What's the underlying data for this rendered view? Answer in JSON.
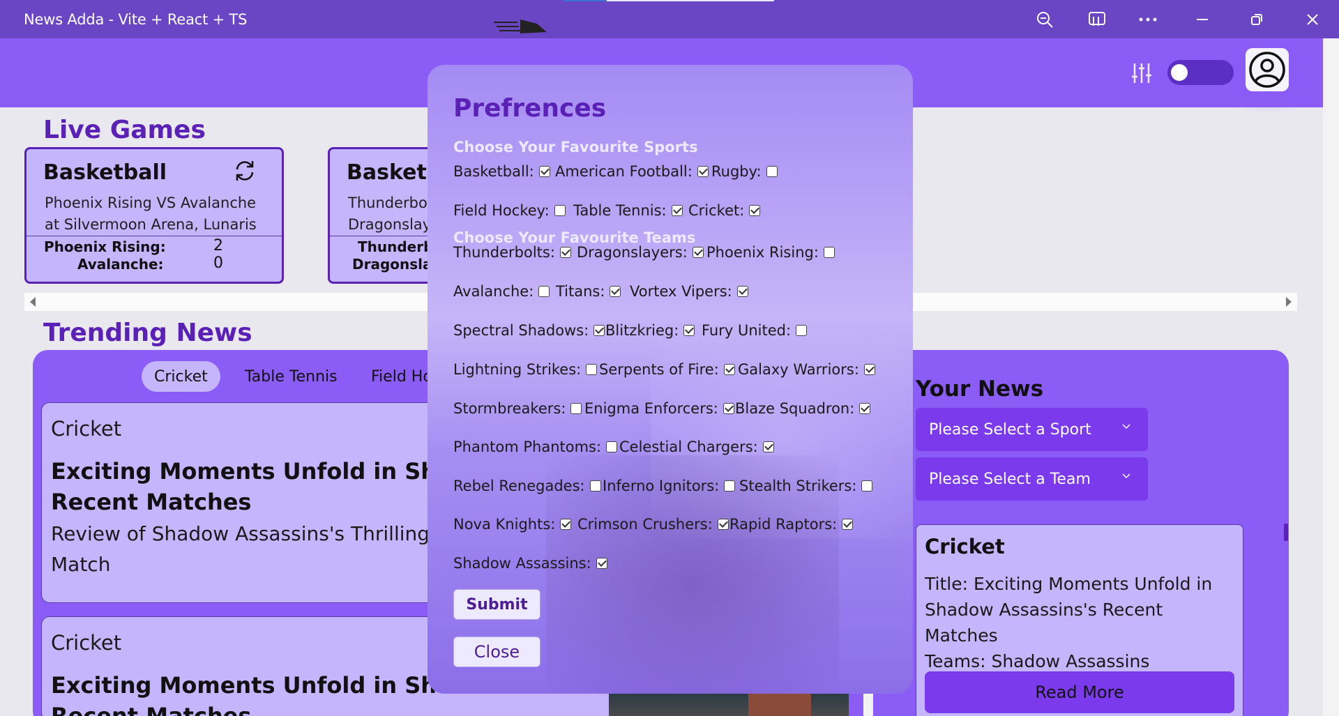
{
  "window": {
    "title": "News Adda - Vite + React + TS"
  },
  "header": {
    "logo_icon": "rocket-logo",
    "theme_toggle_state": "off"
  },
  "live_games": {
    "title": "Live Games",
    "cards": [
      {
        "sport": "Basketball",
        "match": "Phoenix Rising VS Avalanche at Silvermoon Arena, Lunaris",
        "team1": "Phoenix Rising:",
        "score1": "2",
        "team2": "Avalanche:",
        "score2": "0"
      },
      {
        "sport": "Basketball",
        "match": "Thunderbolts VS Dragonslayers at Harmony",
        "team1": "Thunderbolts:",
        "score1": "",
        "team2": "Dragonslayers:",
        "score2": ""
      }
    ]
  },
  "trending": {
    "title": "Trending News",
    "tabs": [
      "Cricket",
      "Table Tennis",
      "Field Hockey"
    ],
    "active_tab": "Cricket",
    "articles": [
      {
        "category": "Cricket",
        "headline": "Exciting Moments Unfold in Shadow Assassins's Recent Matches",
        "summary": "Review of Shadow Assassins's Thrilling Performance in Latest Match"
      },
      {
        "category": "Cricket",
        "headline": "Exciting Moments Unfold in Shadow Assassins's Recent Matches",
        "summary": ""
      }
    ]
  },
  "your_news": {
    "title": "Your News",
    "sport_select": "Please Select a Sport",
    "team_select": "Please Select a Team",
    "card": {
      "category": "Cricket",
      "title_line": "Title: Exciting Moments Unfold in Shadow Assassins's Recent Matches",
      "teams_line": "Teams: Shadow Assassins",
      "read_more": "Read More"
    }
  },
  "preferences": {
    "title": "Prefrences",
    "sports_heading": "Choose Your Favourite Sports",
    "teams_heading": "Choose Your Favourite Teams",
    "sports": [
      {
        "label": "Basketball:",
        "checked": true
      },
      {
        "label": "American Football:",
        "checked": true
      },
      {
        "label": "Rugby:",
        "checked": false
      },
      {
        "label": "Field Hockey:",
        "checked": false
      },
      {
        "label": "Table Tennis:",
        "checked": true
      },
      {
        "label": "Cricket:",
        "checked": true
      }
    ],
    "teams": [
      {
        "label": "Thunderbolts:",
        "checked": true
      },
      {
        "label": "Dragonslayers:",
        "checked": true
      },
      {
        "label": "Phoenix Rising:",
        "checked": false
      },
      {
        "label": "Avalanche:",
        "checked": false
      },
      {
        "label": "Titans:",
        "checked": true
      },
      {
        "label": "Vortex Vipers:",
        "checked": true
      },
      {
        "label": "Spectral Shadows:",
        "checked": true
      },
      {
        "label": "Blitzkrieg:",
        "checked": true
      },
      {
        "label": "Fury United:",
        "checked": false
      },
      {
        "label": "Lightning Strikes:",
        "checked": false
      },
      {
        "label": "Serpents of Fire:",
        "checked": true
      },
      {
        "label": "Galaxy Warriors:",
        "checked": true
      },
      {
        "label": "Stormbreakers:",
        "checked": false
      },
      {
        "label": "Enigma Enforcers:",
        "checked": true
      },
      {
        "label": "Blaze Squadron:",
        "checked": true
      },
      {
        "label": "Phantom Phantoms:",
        "checked": false
      },
      {
        "label": "Celestial Chargers:",
        "checked": true
      },
      {
        "label": "Rebel Renegades:",
        "checked": false
      },
      {
        "label": "Inferno Ignitors:",
        "checked": false
      },
      {
        "label": "Stealth Strikers:",
        "checked": false
      },
      {
        "label": "Nova Knights:",
        "checked": true
      },
      {
        "label": "Crimson Crushers:",
        "checked": true
      },
      {
        "label": "Rapid Raptors:",
        "checked": true
      },
      {
        "label": "Shadow Assassins:",
        "checked": true
      }
    ],
    "submit_label": "Submit",
    "close_label": "Close"
  },
  "colors": {
    "primary": "#8b5cf6",
    "title_bar": "#6a45c4",
    "accent_dark": "#5b21b6",
    "card": "#c4b5fd",
    "button": "#7c3aed"
  }
}
